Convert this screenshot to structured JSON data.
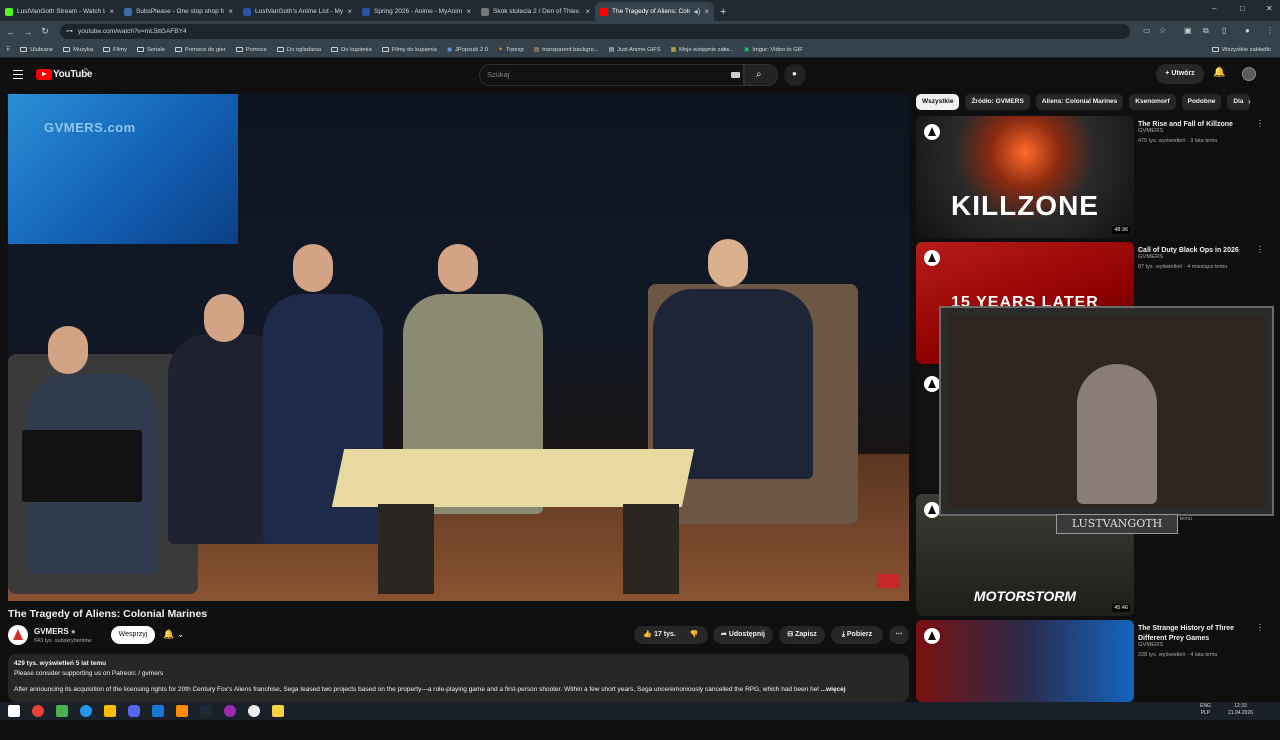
{
  "browser": {
    "tabs": [
      {
        "title": "LustVanGoth Stream - Watch L...",
        "favicon_color": "#53fc18"
      },
      {
        "title": "SubsPlease - One stop shop fo...",
        "favicon_color": "#3a6ea5"
      },
      {
        "title": "LustVanGoth's Anime List - My...",
        "favicon_color": "#2e51a2"
      },
      {
        "title": "Spring 2026 - Anime - MyAnim...",
        "favicon_color": "#2e51a2"
      },
      {
        "title": "Skok stulecia 2 / Den of Thiev...",
        "favicon_color": "#777777"
      },
      {
        "title": "The Tragedy of Aliens: Colo...",
        "favicon_color": "#ff0000"
      }
    ],
    "url": "youtube.com/watch?v=mL5ttGAFBY4",
    "bookmarks": [
      "Ulubiane",
      "Muzyka",
      "Filmy",
      "Seriale",
      "Pomoce do gier",
      "Pomoce",
      "Do ogladania",
      "Do kupienia",
      "Filmy do kupienia",
      "JPopsuki 2.0",
      "Trpexp",
      "transparent backgro...",
      "Just Anime GIFS",
      "Moje wstępnie załw...",
      "Imgur: Video to GIF"
    ],
    "bookmarks_right": "Wszystkie zakładki"
  },
  "youtube": {
    "logo_text": "YouTube",
    "region": "PL",
    "search_placeholder": "Szukaj",
    "create_label": "Utwórz"
  },
  "video": {
    "watermark": "GVMERS.com",
    "title": "The Tragedy of Aliens: Colonial Marines",
    "channel": "GVMERS",
    "subscribers": "543 tys. subskrybentów",
    "join_label": "Wesprzyj",
    "likes": "17 tys.",
    "share_label": "Udostępnij",
    "save_label": "Zapisz",
    "download_label": "Pobierz",
    "views_date": "429 tys. wyświetleń  5 lat temu",
    "patreon_line": "Please consider supporting us on Patreon:  / gvmers",
    "description": "After announcing its acquisition of the licensing rights for 20th Century Fox's Aliens franchise, Sega teased two projects based on the property—a role-playing game and a first-person shooter. Within a few short years, Sega unceremoniously cancelled the RPG, which had been hel",
    "more_label": "...więcej"
  },
  "chips": [
    "Wszystkie",
    "Źródło: GVMERS",
    "Aliens: Colonial Marines",
    "Ksenomorf",
    "Podobne",
    "Dla"
  ],
  "recommendations": [
    {
      "title": "The Rise and Fall of Killzone",
      "channel": "GVMERS",
      "meta": "475 tys. wyświetleń · 3 lata temu",
      "duration": "48:36",
      "thumb_text": "KILLZONE"
    },
    {
      "title": "Call of Duty Black Ops in 2026",
      "channel": "GVMERS",
      "meta": "87 tys. wyświetleń · 4 miesiące temu",
      "duration": "",
      "thumb_text": "15 YEARS LATER"
    },
    {
      "title": "",
      "channel": "",
      "meta": "",
      "duration": "",
      "thumb_text": ""
    },
    {
      "title": "",
      "channel": "",
      "meta": "1 rok temu",
      "duration": "45:46",
      "thumb_text": "MOTORSTORM"
    },
    {
      "title": "The Strange History of Three Different Prey Games",
      "channel": "GVMERS",
      "meta": "228 tys. wyświetleń · 4 lata temu",
      "duration": "",
      "thumb_text": ""
    }
  ],
  "overlay": {
    "name": "LUSTVANGOTH"
  },
  "system": {
    "lang": "ENG",
    "lang2": "PLP",
    "time": "12:33",
    "date": "21.04.2026"
  }
}
